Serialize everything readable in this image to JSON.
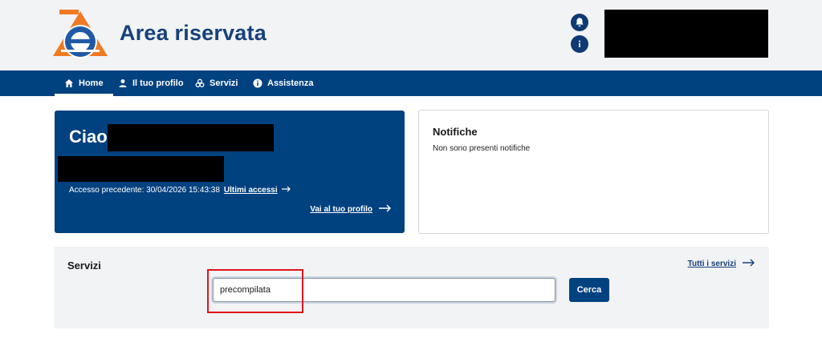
{
  "header": {
    "title": "Area riservata",
    "logo_icon": "agenzia-entrate-logo",
    "bell_icon": "bell-icon",
    "info_icon": "info-icon",
    "brand_color": "#00417f"
  },
  "nav": {
    "items": [
      {
        "label": "Home",
        "icon": "home-icon",
        "active": true
      },
      {
        "label": "Il tuo profilo",
        "icon": "user-icon",
        "active": false
      },
      {
        "label": "Servizi",
        "icon": "services-icon",
        "active": false
      },
      {
        "label": "Assistenza",
        "icon": "info-icon",
        "active": false
      }
    ]
  },
  "welcome": {
    "greeting": "Ciao,",
    "access_prefix": "Accesso precedente: 30/04/2026 15:43:38",
    "last_access_link": "Ultimi accessi",
    "profile_link": "Vai al tuo profilo"
  },
  "notifications": {
    "title": "Notifiche",
    "empty_text": "Non sono presenti notifiche"
  },
  "services": {
    "title": "Servizi",
    "all_link": "Tutti i servizi",
    "search_value": "precompilata",
    "search_button": "Cerca"
  },
  "annotation": {
    "highlight_color": "#e0141e"
  }
}
